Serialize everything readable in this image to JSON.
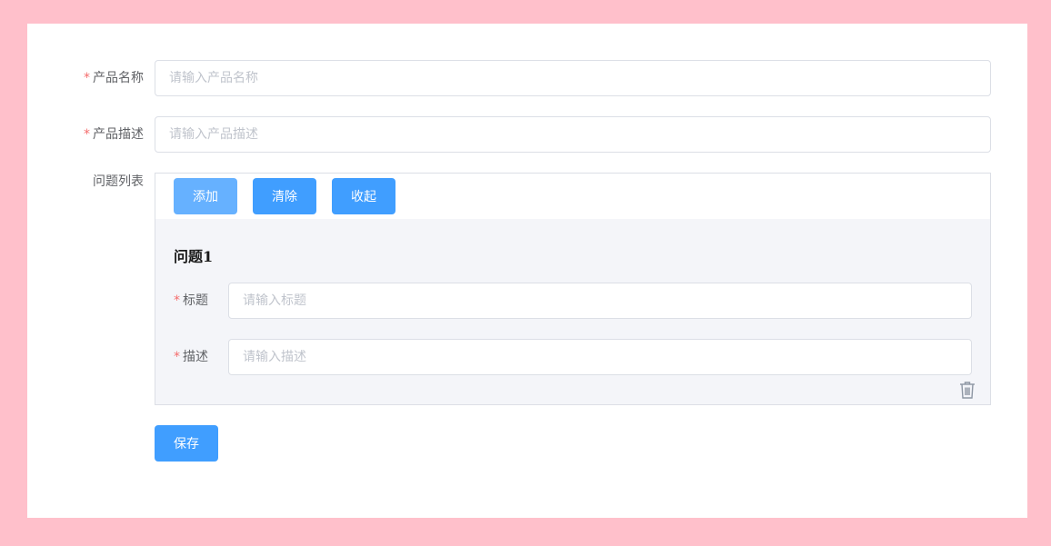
{
  "form": {
    "product_name": {
      "label": "产品名称",
      "placeholder": "请输入产品名称",
      "value": ""
    },
    "product_desc": {
      "label": "产品描述",
      "placeholder": "请输入产品描述",
      "value": ""
    },
    "questions": {
      "label": "问题列表",
      "add_label": "添加",
      "clear_label": "清除",
      "collapse_label": "收起",
      "items": [
        {
          "title": "问题1",
          "title_field": {
            "label": "标题",
            "placeholder": "请输入标题",
            "value": ""
          },
          "desc_field": {
            "label": "描述",
            "placeholder": "请输入描述",
            "value": ""
          }
        }
      ]
    },
    "save_label": "保存",
    "required_mark": "*"
  },
  "colors": {
    "page_bg": "#ffc0cb",
    "primary": "#409eff",
    "primary_light": "#66b1ff",
    "required": "#f56c6c",
    "panel_bg": "#f4f5f9"
  },
  "icons": {
    "delete": "trash-icon"
  }
}
